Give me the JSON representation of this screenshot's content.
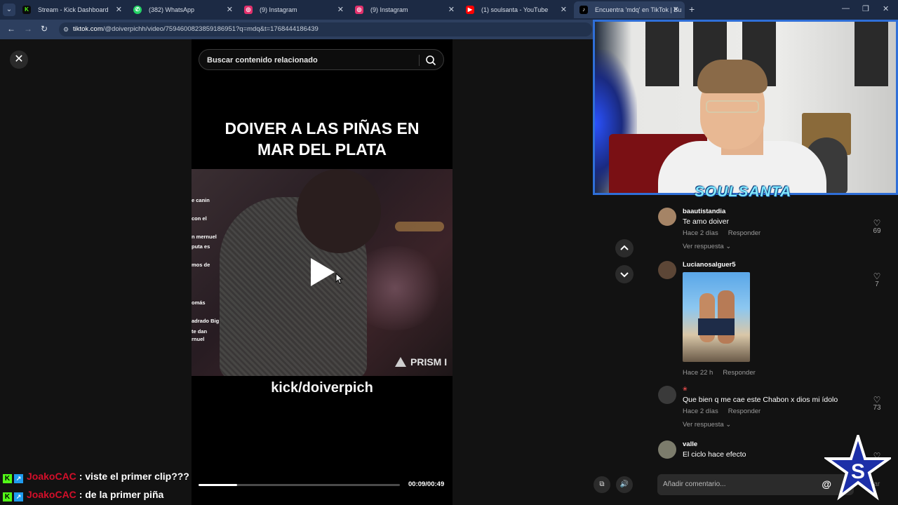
{
  "browser": {
    "tabs": [
      {
        "label": "Stream - Kick Dashboard",
        "icon": "kick-icon",
        "color": "#53fc18"
      },
      {
        "label": "(382) WhatsApp",
        "icon": "whatsapp-icon",
        "color": "#25d366"
      },
      {
        "label": "(9) Instagram",
        "icon": "instagram-icon",
        "color": "#e1306c"
      },
      {
        "label": "(9) Instagram",
        "icon": "instagram-icon",
        "color": "#e1306c"
      },
      {
        "label": "(1) soulsanta - YouTube",
        "icon": "youtube-icon",
        "color": "#ff0000"
      },
      {
        "label": "Encuentra 'mdq' en TikTok | Bu",
        "icon": "tiktok-icon",
        "color": "#000000"
      }
    ],
    "url_host": "tiktok.com",
    "url_path": "/@doiverpichh/video/7594600823859186951?q=mdq&t=1768444186439"
  },
  "player": {
    "search_placeholder": "Buscar contenido relacionado",
    "title_line1": "DOIVER A LAS PIÑAS EN",
    "title_line2": "MAR DEL PLATA",
    "overlay_lines": [
      "e canin",
      "con el",
      "n mernuel",
      "puta es",
      "mos de",
      "omás",
      "adrado Big",
      "te dan",
      "rnuel"
    ],
    "watermark": "PRISM I",
    "caption": "kick/doiverpich",
    "time": "00:09/00:49",
    "progress": 0.19
  },
  "comments": [
    {
      "user": "baautistandia",
      "text": "Te amo doiver",
      "time": "Hace 2 días",
      "reply": "Responder",
      "more": "Ver respuesta",
      "likes": "69"
    },
    {
      "user": "Lucianosalguer5",
      "text": "",
      "time": "Hace 22 h",
      "reply": "Responder",
      "more": "",
      "likes": "7"
    },
    {
      "user": "",
      "text": "Que bien q me cae este Chabon x dios mi ídolo",
      "time": "Hace 2 días",
      "reply": "Responder",
      "more": "Ver respuesta",
      "likes": "73"
    },
    {
      "user": "valle",
      "text": "El ciclo hace efecto",
      "time": "",
      "reply": "",
      "more": "",
      "likes": ""
    }
  ],
  "comment_input": {
    "placeholder": "Añadir comentario...",
    "at": "@",
    "post": "licar"
  },
  "stream": {
    "channel_logo": "SOULSANTA",
    "chat": [
      {
        "user": "JoakoCAC",
        "separator": ":",
        "message": "viste el primer clip???"
      },
      {
        "user": "JoakoCAC",
        "separator": ":",
        "message": "de la primer piña"
      }
    ]
  }
}
